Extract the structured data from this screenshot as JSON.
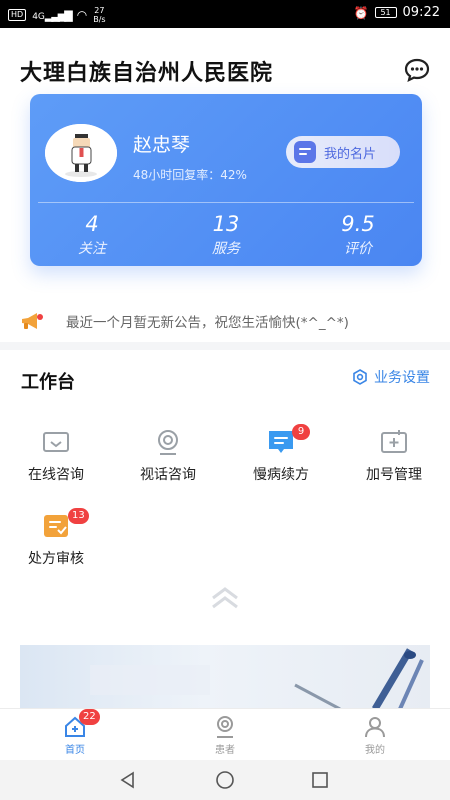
{
  "status_bar": {
    "network_tag": "HD",
    "signal_tag": "4G",
    "net_speed_value": "27",
    "net_speed_unit": "B/s",
    "battery": "51",
    "time": "09:22"
  },
  "header": {
    "title": "大理白族自治州人民医院",
    "chat_icon": "chat-bubble-icon"
  },
  "profile": {
    "name": "赵忠琴",
    "review_rate": "48小时回复率：42%",
    "card_button": "我的名片",
    "stats": [
      {
        "value": "4",
        "label": "关注"
      },
      {
        "value": "13",
        "label": "服务"
      },
      {
        "value": "9.5",
        "label": "评价"
      }
    ]
  },
  "notice": {
    "icon": "megaphone-icon",
    "text": "最近一个月暂无新公告，祝您生活愉快(*^_^*)"
  },
  "workbench": {
    "title": "工作台",
    "settings_label": "业务设置",
    "tiles": [
      {
        "label": "在线咨询",
        "icon": "online-consult-icon",
        "badge": ""
      },
      {
        "label": "视话咨询",
        "icon": "video-consult-icon",
        "badge": ""
      },
      {
        "label": "慢病续方",
        "icon": "chronic-renewal-icon",
        "badge": "9"
      },
      {
        "label": "加号管理",
        "icon": "appointment-manage-icon",
        "badge": ""
      },
      {
        "label": "处方审核",
        "icon": "prescription-review-icon",
        "badge": "13"
      }
    ]
  },
  "tabbar": {
    "tabs": [
      {
        "label": "首页",
        "icon": "home-icon",
        "badge": "22",
        "active": true
      },
      {
        "label": "患者",
        "icon": "patient-icon",
        "badge": "",
        "active": false
      },
      {
        "label": "我的",
        "icon": "profile-icon",
        "badge": "",
        "active": false
      }
    ]
  },
  "colors": {
    "accent": "#3a86e6",
    "card_gradient_start": "#5e9cf7",
    "card_gradient_end": "#4a86f2",
    "badge": "#f04141",
    "tile_orange": "#f2a23a",
    "tile_blue": "#3a9af0"
  }
}
